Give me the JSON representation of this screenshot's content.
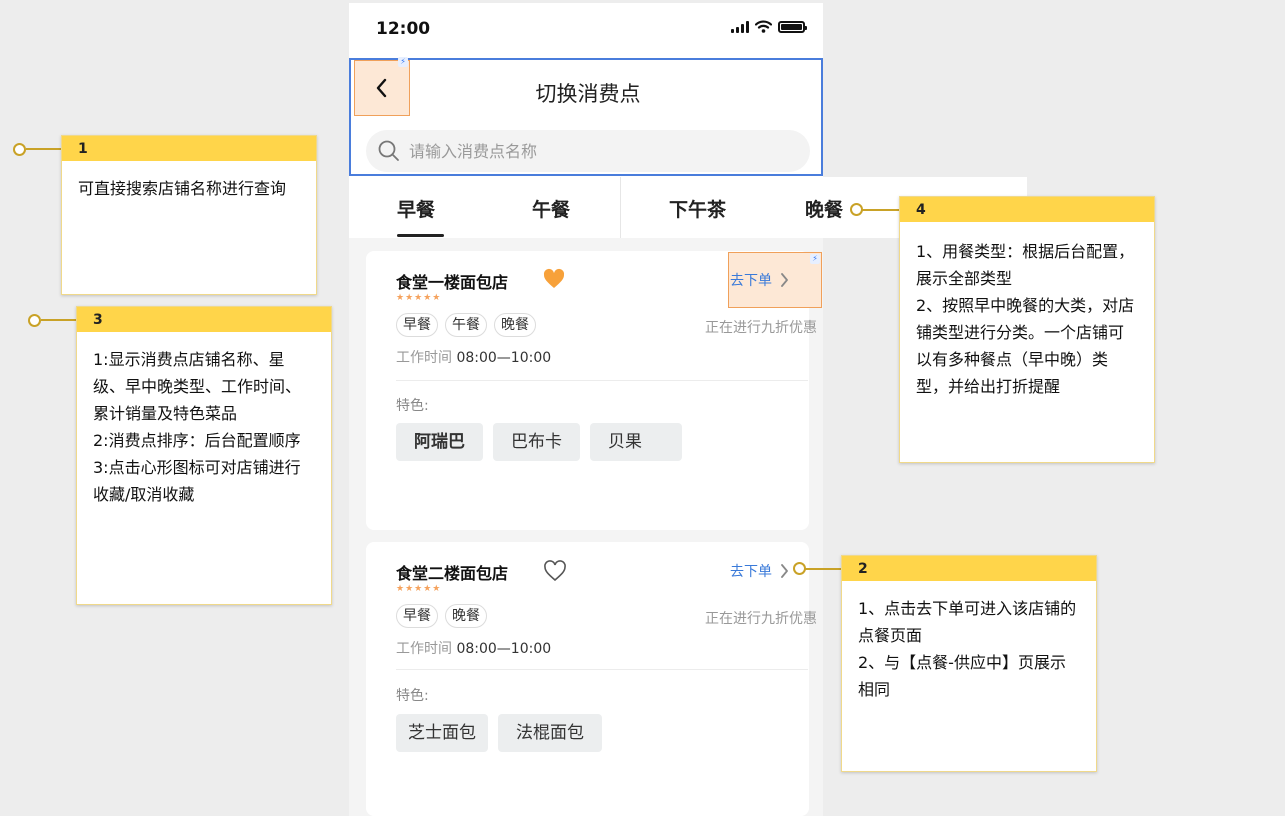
{
  "status_bar": {
    "time": "12:00"
  },
  "header": {
    "title": "切换消费点",
    "search_placeholder": "请输入消费点名称"
  },
  "tabs": [
    "早餐",
    "午餐",
    "下午茶",
    "晚餐"
  ],
  "active_tab": "早餐",
  "shops": [
    {
      "name": "食堂一楼面包店",
      "favorite": true,
      "rating": 5,
      "stars": "★★★★★",
      "meal_types": [
        "早餐",
        "午餐",
        "晚餐"
      ],
      "discount": "正在进行九折优惠",
      "work_label": "工作时间",
      "work_time": "08:00—10:00",
      "feature_label": "特色:",
      "features": [
        "阿瑞巴",
        "巴布卡",
        "贝果"
      ],
      "order_label": "去下单"
    },
    {
      "name": "食堂二楼面包店",
      "favorite": false,
      "rating": 5,
      "stars": "★★★★★",
      "meal_types": [
        "早餐",
        "晚餐"
      ],
      "discount": "正在进行九折优惠",
      "work_label": "工作时间",
      "work_time": "08:00—10:00",
      "feature_label": "特色:",
      "features": [
        "芝士面包",
        "法棍面包"
      ],
      "order_label": "去下单"
    }
  ],
  "annotations": [
    {
      "id": "1",
      "text": "可直接搜索店铺名称进行查询"
    },
    {
      "id": "3",
      "lines": [
        "1:显示消费点店铺名称、星级、早中晚类型、工作时间、累计销量及特色菜品",
        "2:消费点排序：后台配置顺序",
        "3:点击心形图标可对店铺进行收藏/取消收藏"
      ]
    },
    {
      "id": "4",
      "lines": [
        "1、用餐类型：根据后台配置，展示全部类型",
        "2、按照早中晚餐的大类，对店铺类型进行分类。一个店铺可以有多种餐点（早中晚）类型，并给出打折提醒"
      ]
    },
    {
      "id": "2",
      "lines": [
        "1、点击去下单可进入该店铺的点餐页面",
        "2、与【点餐-供应中】页展示相同"
      ]
    }
  ],
  "colors": {
    "accent_blue": "#3a7ad9",
    "note_header": "#ffd54a",
    "highlight_fill": "#fde8d6",
    "selection_border": "#4a7ddc",
    "star": "#f5a25d"
  },
  "icons": [
    "signal-icon",
    "wifi-icon",
    "battery-icon",
    "back-arrow-icon",
    "search-icon",
    "heart-filled-icon",
    "heart-outline-icon",
    "chevron-right-icon"
  ]
}
